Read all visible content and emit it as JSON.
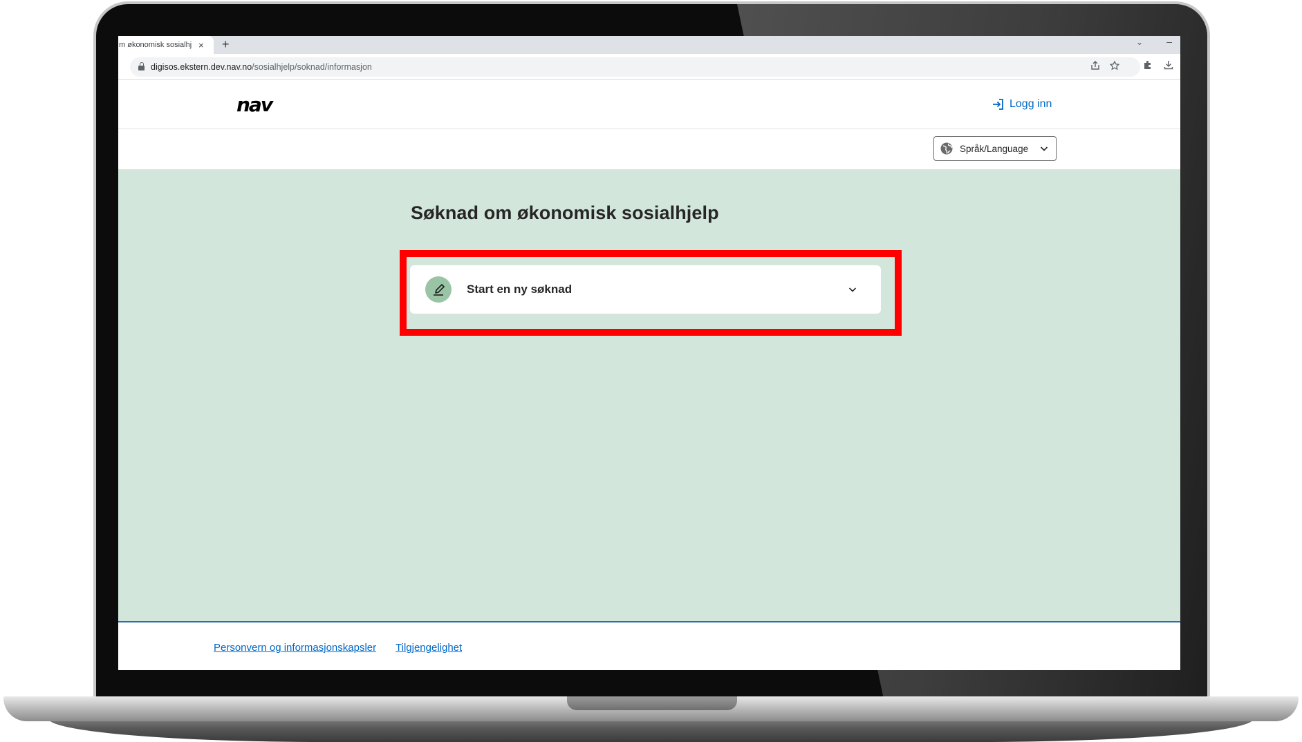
{
  "browser": {
    "tab_title": "m økonomisk sosialhje",
    "tab_close": "×",
    "new_tab": "+",
    "url_host": "digisos.ekstern.dev.nav.no",
    "url_path": "/sosialhjelp/soknad/informasjon"
  },
  "header": {
    "logo_text": "nav",
    "login_label": "Logg inn"
  },
  "language": {
    "label": "Språk/Language"
  },
  "main": {
    "title": "Søknad om økonomisk sosialhjelp",
    "accordion_label": "Start en ny søknad"
  },
  "footer": {
    "links": [
      "Personvern og informasjonskapsler",
      "Tilgjengelighet"
    ]
  },
  "colors": {
    "accent_blue": "#0067c5",
    "page_green": "#d3e6db",
    "icon_green": "#99c4a5",
    "highlight_red": "#ff0000"
  }
}
